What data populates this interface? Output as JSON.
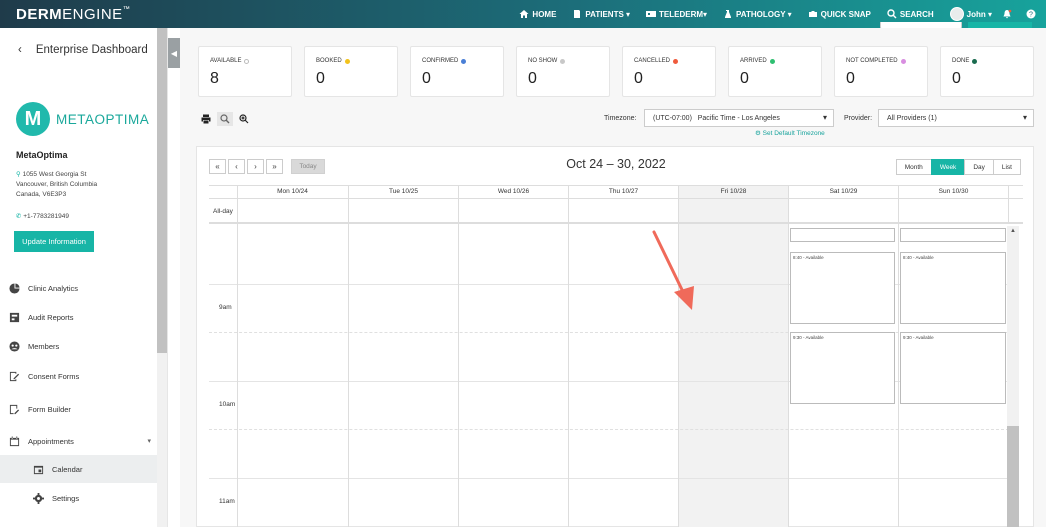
{
  "topbar": {
    "logo_bold": "DERM",
    "logo_light": "ENGINE",
    "logo_tm": "™",
    "nav": [
      {
        "label": "HOME",
        "icon": "home-icon"
      },
      {
        "label": "PATIENTS ▾",
        "icon": "patients-icon"
      },
      {
        "label": "TELEDERM▾",
        "icon": "telederm-icon"
      },
      {
        "label": "PATHOLOGY ▾",
        "icon": "pathology-icon"
      },
      {
        "label": "QUICK SNAP",
        "icon": "camera-icon"
      },
      {
        "label": "SEARCH",
        "icon": "search-icon"
      }
    ],
    "user": "John ▾"
  },
  "sidebar": {
    "back_label": "Enterprise Dashboard",
    "brand_letter": "M",
    "brand_name": "METAOPTIMA",
    "clinic_name": "MetaOptima",
    "address_line1": "1055 West Georgia St",
    "address_line2": "Vancouver, British Columbia",
    "address_line3": "Canada, V6E3P3",
    "phone": "+1-7783281949",
    "update_button": "Update Information",
    "menu": [
      {
        "label": "Clinic Analytics",
        "icon": "pie-chart-icon"
      },
      {
        "label": "Audit Reports",
        "icon": "report-icon"
      },
      {
        "label": "Members",
        "icon": "members-icon"
      },
      {
        "label": "Consent Forms",
        "icon": "consent-icon"
      },
      {
        "label": "Form Builder",
        "icon": "form-builder-icon"
      },
      {
        "label": "Appointments",
        "icon": "calendar-icon"
      },
      {
        "label": "Calendar",
        "icon": "calendar-small-icon"
      },
      {
        "label": "Settings",
        "icon": "gear-icon"
      }
    ]
  },
  "stats": [
    {
      "label": "AVAILABLE",
      "value": "8",
      "color": "#ffffff",
      "ring": true
    },
    {
      "label": "BOOKED",
      "value": "0",
      "color": "#f2c21b"
    },
    {
      "label": "CONFIRMED",
      "value": "0",
      "color": "#4a7fd6"
    },
    {
      "label": "NO SHOW",
      "value": "0",
      "color": "#c8c8c8"
    },
    {
      "label": "CANCELLED",
      "value": "0",
      "color": "#ef5a3c"
    },
    {
      "label": "ARRIVED",
      "value": "0",
      "color": "#2fbf71"
    },
    {
      "label": "NOT COMPLETED",
      "value": "0",
      "color": "#d88ee0"
    },
    {
      "label": "DONE",
      "value": "0",
      "color": "#1a6b4f"
    }
  ],
  "filters": {
    "timezone_label": "Timezone:",
    "timezone_value": "(UTC-07:00)   Pacific Time - Los Angeles",
    "set_default": "Set Default Timezone",
    "provider_label": "Provider:",
    "provider_value": "All Providers (1)"
  },
  "calendar": {
    "nav": [
      "«",
      "‹",
      "›",
      "»"
    ],
    "today_label": "Today",
    "title": "Oct 24 – 30, 2022",
    "views": [
      "Month",
      "Week",
      "Day",
      "List"
    ],
    "active_view": "Week",
    "days": [
      "Mon 10/24",
      "Tue 10/25",
      "Wed 10/26",
      "Thu 10/27",
      "Fri 10/28",
      "Sat 10/29",
      "Sun 10/30"
    ],
    "allday_label": "All-day",
    "times": [
      "9am",
      "10am",
      "11am"
    ],
    "slots": [
      {
        "label": "8:40 - Available"
      },
      {
        "label": "8:40 - Available"
      },
      {
        "label": "9:30 - Available"
      },
      {
        "label": "9:30 - Available"
      }
    ]
  },
  "colors": {
    "accent": "#17b5a6",
    "annotation_arrow": "#f06a5a"
  }
}
